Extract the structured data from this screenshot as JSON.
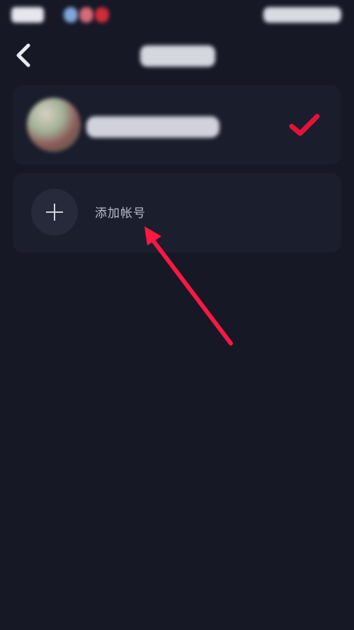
{
  "status_bar": {
    "time": "",
    "notification_dot_colors": [
      "#7fa7d9",
      "#d66a7a",
      "#d02c3a"
    ]
  },
  "header": {
    "title": ""
  },
  "accounts": [
    {
      "name": "",
      "selected": true
    }
  ],
  "add_account": {
    "label": "添加帐号"
  },
  "colors": {
    "background": "#161826",
    "card": "#1a1d2c",
    "accent_red": "#e3123a",
    "annotation_arrow": "#ff1744"
  }
}
